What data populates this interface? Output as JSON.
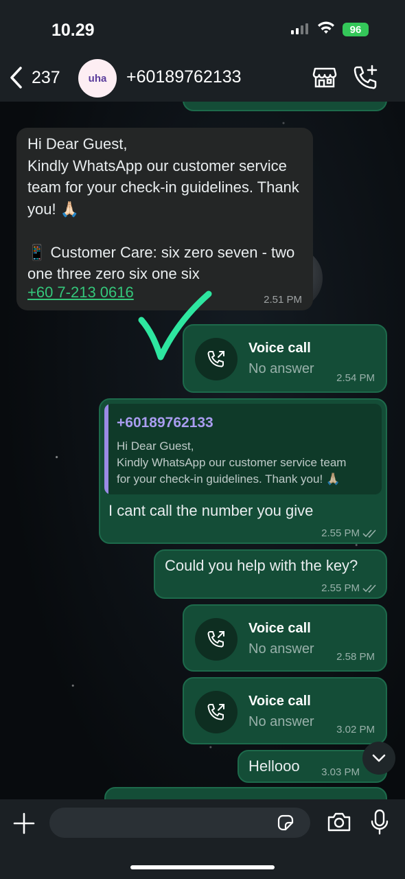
{
  "status_bar": {
    "time": "10.29",
    "battery": "96"
  },
  "header": {
    "back_count": "237",
    "avatar_text": "uha",
    "contact_name": "+60189762133"
  },
  "messages": {
    "incoming": {
      "text": "Hi Dear Guest,\nKindly WhatsApp our customer service team for your check-in guidelines. Thank you! 🙏🏻\n\n📱 Customer Care:  six zero seven - two one three zero six one six",
      "link": "+60 7-213 0616",
      "time": "2.51 PM"
    },
    "call1": {
      "title": "Voice call",
      "status": "No answer",
      "time": "2.54 PM"
    },
    "reply": {
      "quoted_name": "+60189762133",
      "quoted_text": "Hi Dear Guest,\nKindly WhatsApp our customer service team\nfor your check-in guidelines. Thank you! 🙏🏻",
      "text": "I cant call the number you give",
      "time": "2.55 PM"
    },
    "key_question": {
      "text": "Could you help with the key?",
      "time": "2.55 PM"
    },
    "call2": {
      "title": "Voice call",
      "status": "No answer",
      "time": "2.58 PM"
    },
    "call3": {
      "title": "Voice call",
      "status": "No answer",
      "time": "3.02 PM"
    },
    "hello": {
      "text": "Hellooo",
      "time": "3.03 PM"
    }
  },
  "composer": {
    "placeholder": ""
  },
  "colors": {
    "outgoing_bubble": "#144d37",
    "incoming_bubble": "#242626",
    "link": "#34c77b",
    "checkmark_annotation": "#2ee6a0"
  }
}
